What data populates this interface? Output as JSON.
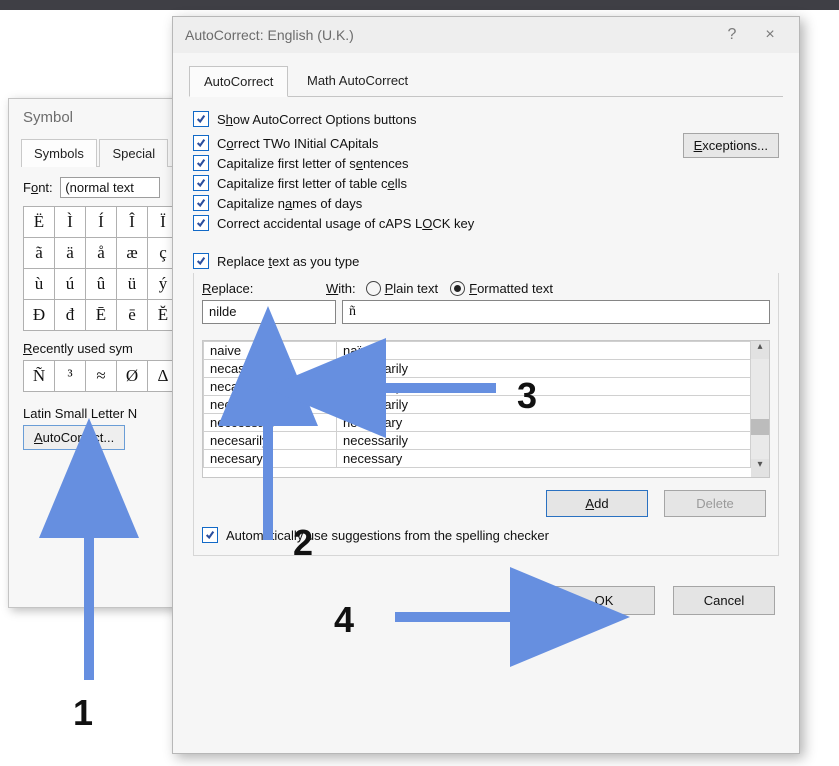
{
  "topbar": {
    "present": true
  },
  "symbol": {
    "title": "Symbol",
    "tabs": {
      "symbols": "Symbols",
      "special": "Special"
    },
    "font_label_pre": "F",
    "font_label_u": "o",
    "font_label_post": "nt:",
    "font_value": "(normal text",
    "grid": [
      [
        "Ë",
        "Ì",
        "Í",
        "Î",
        "Ï"
      ],
      [
        "ã",
        "ä",
        "å",
        "æ",
        "ç"
      ],
      [
        "ù",
        "ú",
        "û",
        "ü",
        "ý"
      ],
      [
        "Đ",
        "đ",
        "Ē",
        "ē",
        "Ĕ"
      ]
    ],
    "recent_label_pre": "",
    "recent_label_u": "R",
    "recent_label_post": "ecently used sym",
    "recent": [
      "Ñ",
      "³",
      "≈",
      "Ø",
      "Δ"
    ],
    "selected_char_label": "Latin Small Letter N",
    "ac_btn_pre": "",
    "ac_btn_u": "A",
    "ac_btn_post": "utoCorrect..."
  },
  "ac": {
    "title": "AutoCorrect: English (U.K.)",
    "help": "?",
    "close": "×",
    "tabs": {
      "ac": "AutoCorrect",
      "math": "Math AutoCorrect"
    },
    "chk_show": {
      "pre": "S",
      "u": "h",
      "post": "ow AutoCorrect Options buttons"
    },
    "chk_caps": {
      "pre": "C",
      "u": "o",
      "post": "rrect TWo INitial CApitals"
    },
    "chk_sent": {
      "pre": "Capitalize first letter of s",
      "u": "e",
      "post": "ntences"
    },
    "chk_cells": {
      "pre": "Capitalize first letter of table c",
      "u": "e",
      "post": "lls"
    },
    "chk_days": {
      "pre": "Capitalize n",
      "u": "a",
      "post": "mes of days"
    },
    "chk_lock": {
      "pre": "Correct accidental usage of cAPS L",
      "u": "O",
      "post": "CK key"
    },
    "chk_rep": {
      "pre": "Replace ",
      "u": "t",
      "post": "ext as you type"
    },
    "chk_sugg": {
      "pre": "Automatically use suggestions from the spelling checker",
      "u": "",
      "post": ""
    },
    "exceptions_pre": "",
    "exceptions_u": "E",
    "exceptions_post": "xceptions...",
    "replace_label_pre": "",
    "replace_label_u": "R",
    "replace_label_post": "eplace:",
    "with_label_pre": "",
    "with_label_u": "W",
    "with_label_post": "ith:",
    "radio_plain_pre": "",
    "radio_plain_u": "P",
    "radio_plain_post": "lain text",
    "radio_fmt_pre": "",
    "radio_fmt_u": "F",
    "radio_fmt_post": "ormatted text",
    "radio_selected": "formatted",
    "replace_value": "nilde",
    "with_value": "ñ",
    "list": [
      {
        "a": "naive",
        "b": "naïve"
      },
      {
        "a": "necassarily",
        "b": "necessarily"
      },
      {
        "a": "necassary",
        "b": "necessary"
      },
      {
        "a": "neccessarily",
        "b": "necessarily"
      },
      {
        "a": "neccessary",
        "b": "necessary"
      },
      {
        "a": "necesarily",
        "b": "necessarily"
      },
      {
        "a": "necesary",
        "b": "necessary"
      }
    ],
    "add_pre": "",
    "add_u": "A",
    "add_post": "dd",
    "delete": "Delete",
    "ok": "OK",
    "cancel": "Cancel"
  },
  "annotations": {
    "n1": "1",
    "n2": "2",
    "n3": "3",
    "n4": "4"
  }
}
